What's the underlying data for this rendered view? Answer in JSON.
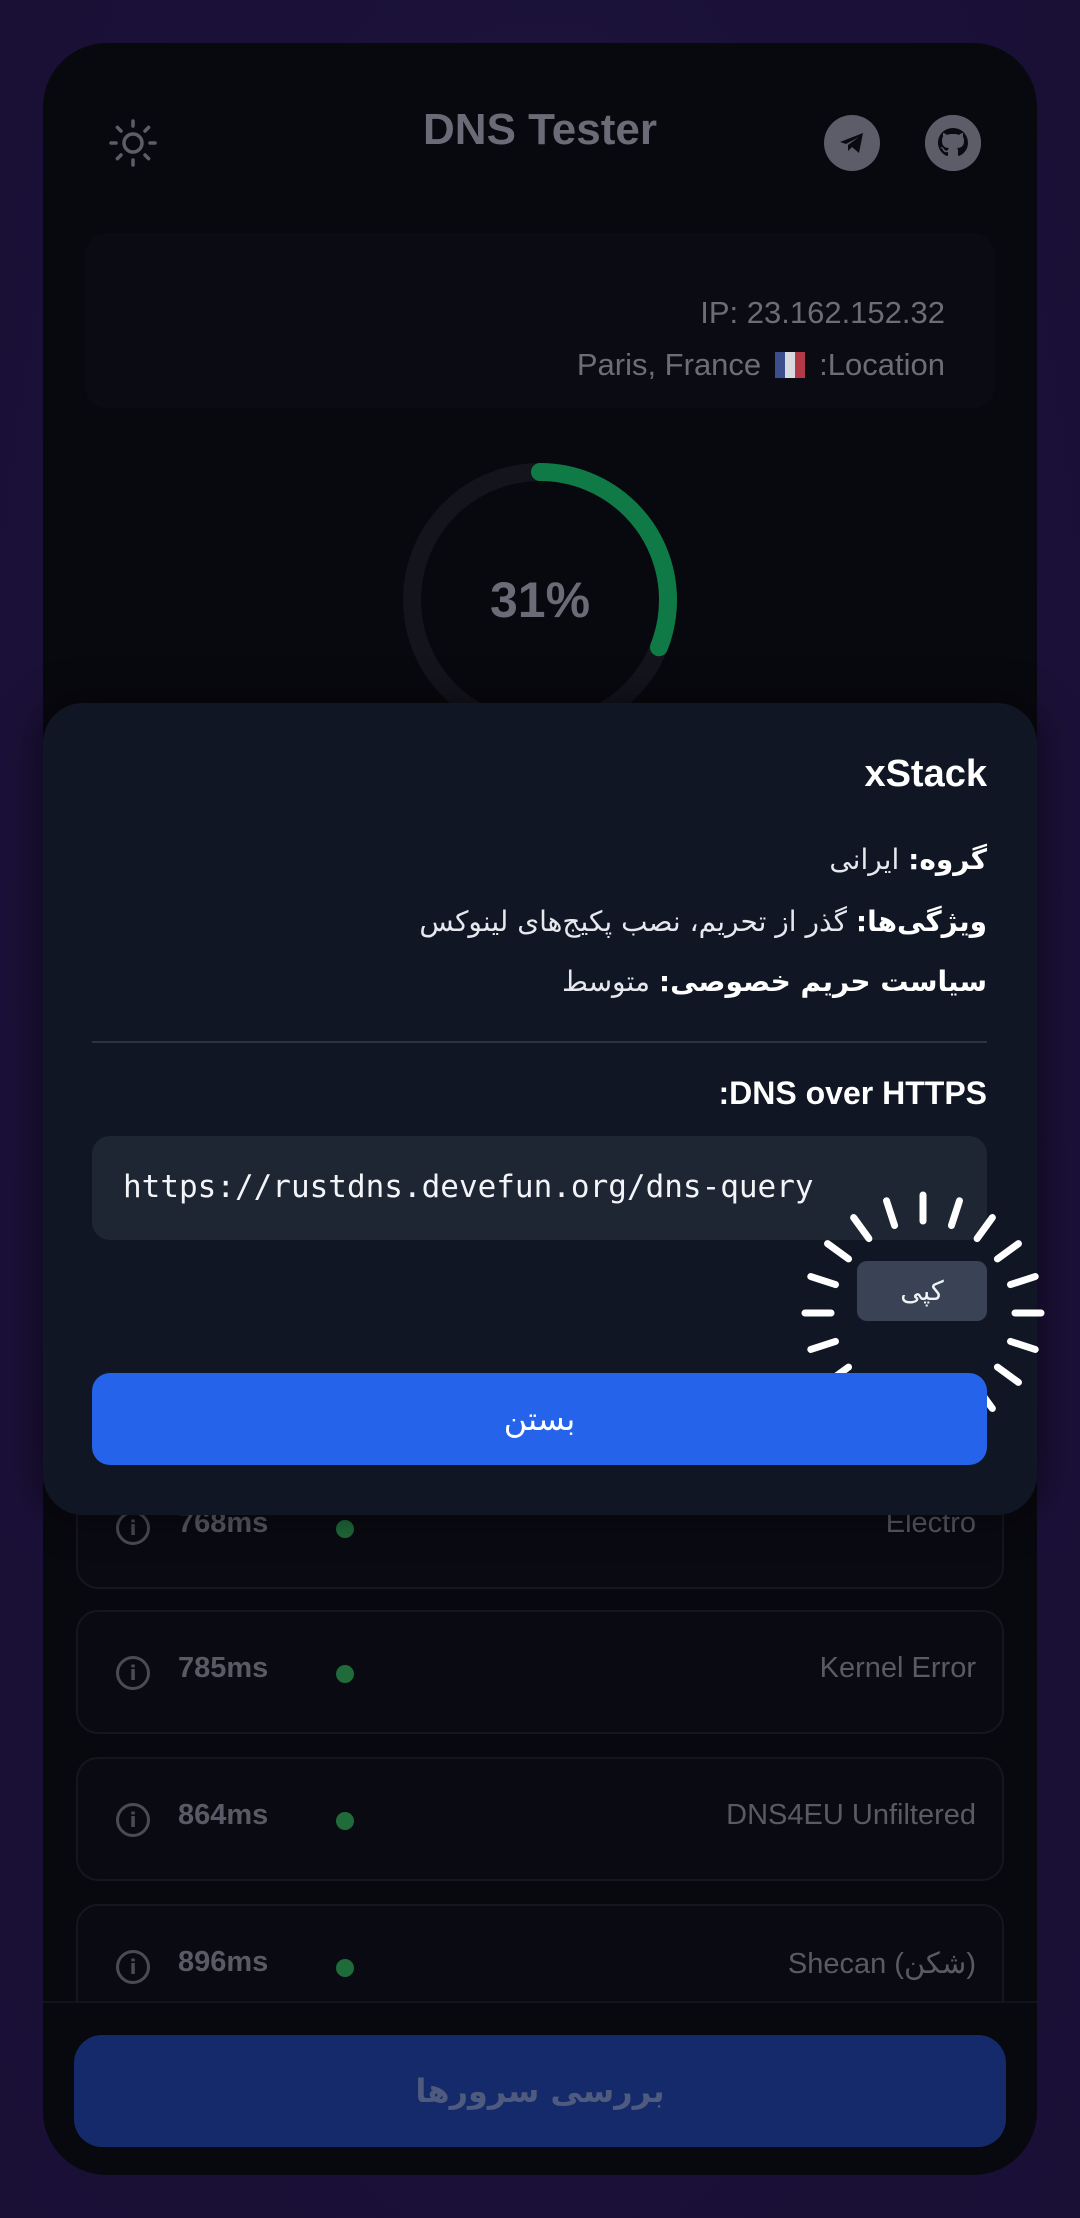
{
  "header": {
    "title": "DNS Tester",
    "theme_icon": "sun-icon",
    "telegram_icon": "telegram-icon",
    "github_icon": "github-icon"
  },
  "info": {
    "ip": "IP: 23.162.152.32",
    "location_label": ":Location",
    "location_value": "Paris, France"
  },
  "progress": {
    "text": "31%",
    "fraction": 0.31,
    "color": "#0f7a45"
  },
  "servers": [
    {
      "ms": "768ms",
      "name": "Electro"
    },
    {
      "ms": "785ms",
      "name": "Kernel Error"
    },
    {
      "ms": "864ms",
      "name": "DNS4EU Unfiltered"
    },
    {
      "ms": "896ms",
      "name": "Shecan (شکن)"
    }
  ],
  "footer": {
    "check_button": "بررسی سرورها"
  },
  "modal": {
    "title": "xStack",
    "group_label": "گروه:",
    "group_value": "ایرانی",
    "features_label": "ویژگی‌ها:",
    "features_value": "گذر از تحریم، نصب پکیج‌های لینوکس",
    "privacy_label": "سیاست حریم خصوصی:",
    "privacy_value": "متوسط",
    "doh_label": "DNS over HTTPS:",
    "doh_url": "https://rustdns.devefun.org/dns-query",
    "copy_button": "کپی",
    "close_button": "بستن"
  },
  "colors": {
    "accent": "#2563eb",
    "status_dot": "#1f6b3a"
  }
}
